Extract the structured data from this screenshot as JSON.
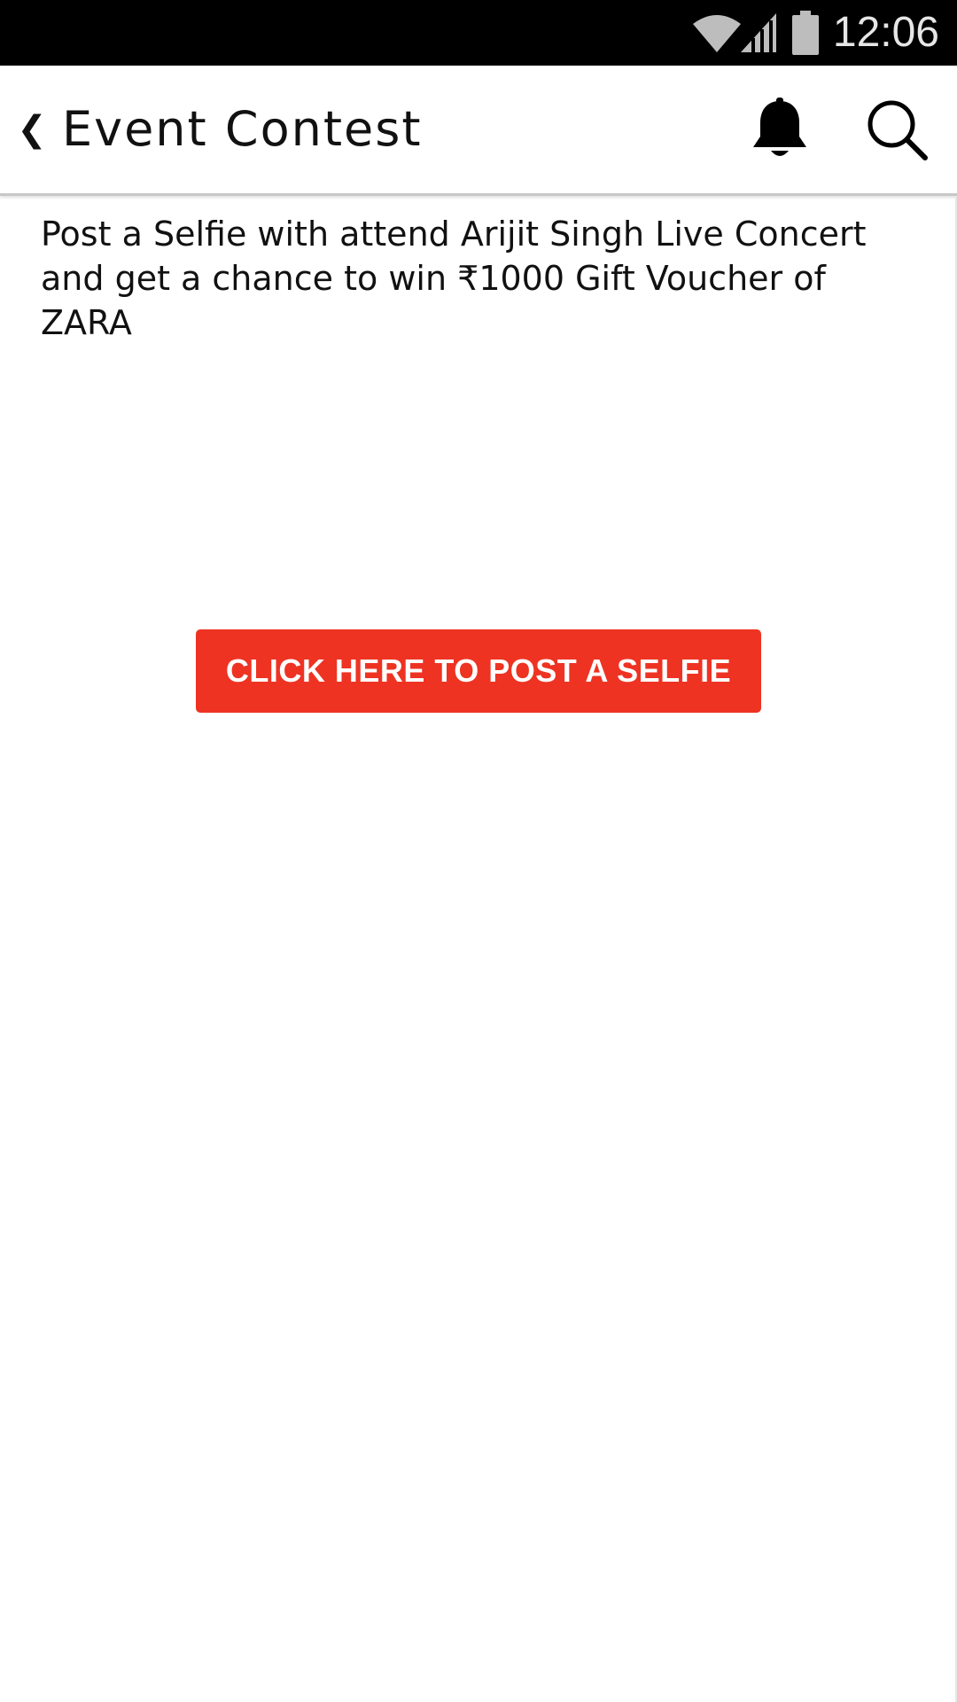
{
  "status_bar": {
    "time": "12:06",
    "icons": [
      "wifi-icon",
      "signal-icon",
      "battery-icon"
    ]
  },
  "app_bar": {
    "back_glyph": "❮",
    "title": "Event Contest",
    "icons": [
      "notification-bell-icon",
      "search-icon"
    ]
  },
  "contest": {
    "description": "Post a Selfie with attend Arijit Singh Live Concert and get a chance to win ₹1000 Gift Voucher of ZARA",
    "button_label": "CLICK HERE TO POST A SELFIE"
  },
  "colors": {
    "accent": "#ee3322",
    "status_bar_bg": "#000000",
    "background": "#ffffff"
  }
}
